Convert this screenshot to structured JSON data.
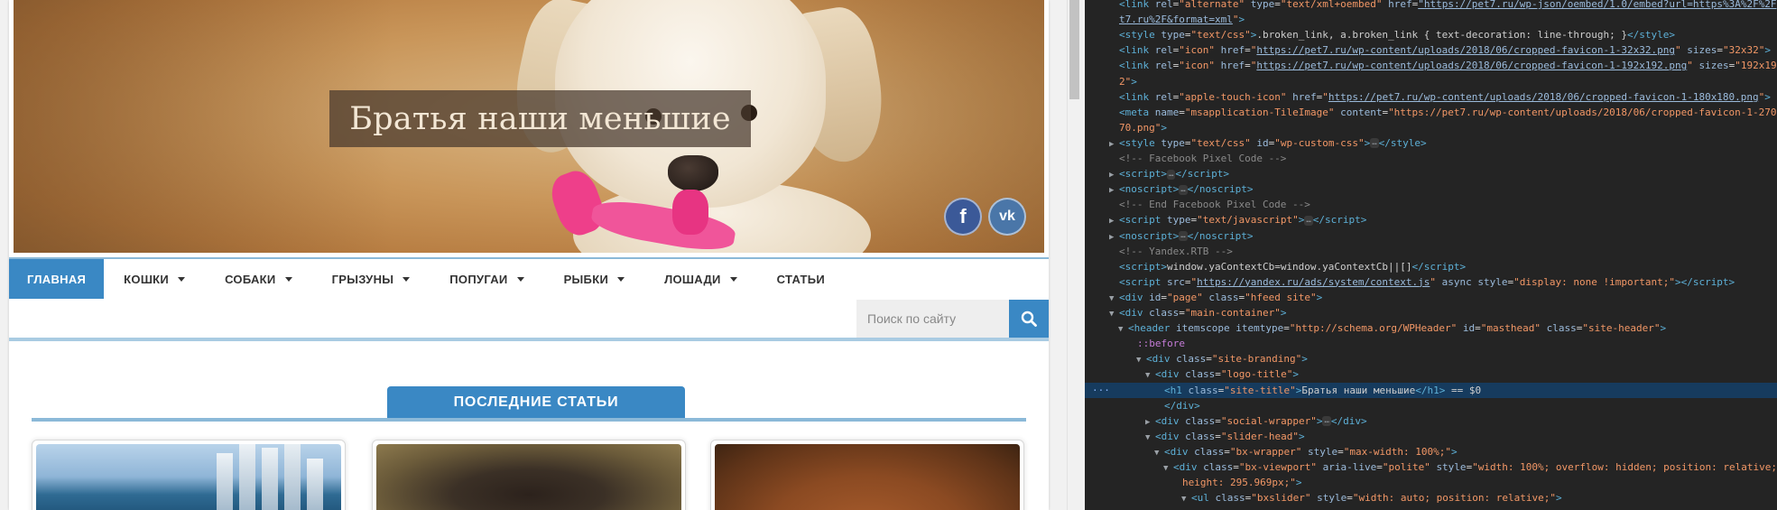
{
  "site": {
    "title": "Братья наши меньшие",
    "social": {
      "facebook_label": "f",
      "vk_label": "vk"
    },
    "nav": {
      "items": [
        {
          "label": "ГЛАВНАЯ",
          "active": true,
          "dropdown": false
        },
        {
          "label": "КОШКИ",
          "active": false,
          "dropdown": true
        },
        {
          "label": "СОБАКИ",
          "active": false,
          "dropdown": true
        },
        {
          "label": "ГРЫЗУНЫ",
          "active": false,
          "dropdown": true
        },
        {
          "label": "ПОПУГАИ",
          "active": false,
          "dropdown": true
        },
        {
          "label": "РЫБКИ",
          "active": false,
          "dropdown": true
        },
        {
          "label": "ЛОШАДИ",
          "active": false,
          "dropdown": true
        },
        {
          "label": "СТАТЬИ",
          "active": false,
          "dropdown": false
        }
      ]
    },
    "search": {
      "placeholder": "Поиск по сайту"
    },
    "latest_heading": "ПОСЛЕДНИЕ СТАТЬИ",
    "colors": {
      "accent": "#3a88c4",
      "accent_light": "#8bb9d8"
    }
  },
  "devtools": {
    "lines": [
      {
        "html": "<span class=\"t\">&lt;link</span> <span class=\"an\">rel</span>=<span class=\"av\">\"alternate\"</span> <span class=\"an\">type</span>=<span class=\"av\">\"text/xml+oembed\"</span> <span class=\"an\">href</span>=<span class=\"lk\">\"https://pet7.ru/wp-json/oembed/1.0/embed?url=https%3A%2F%2Fpe</span>"
      },
      {
        "html": "<span class=\"lk\">t7.ru%2F&amp;format=xml</span><span class=\"av\">\"</span><span class=\"t\">&gt;</span>"
      },
      {
        "html": "<span class=\"t\">&lt;style</span> <span class=\"an\">type</span>=<span class=\"av\">\"text/css\"</span><span class=\"t\">&gt;</span><span class=\"tx\">.broken_link, a.broken_link { text-decoration: line-through; }</span><span class=\"t\">&lt;/style&gt;</span>"
      },
      {
        "html": "<span class=\"t\">&lt;link</span> <span class=\"an\">rel</span>=<span class=\"av\">\"icon\"</span> <span class=\"an\">href</span>=<span class=\"av\">\"</span><span class=\"lk\">https://pet7.ru/wp-content/uploads/2018/06/cropped-favicon-1-32x32.png</span><span class=\"av\">\"</span> <span class=\"an\">sizes</span>=<span class=\"av\">\"32x32\"</span><span class=\"t\">&gt;</span>"
      },
      {
        "html": "<span class=\"t\">&lt;link</span> <span class=\"an\">rel</span>=<span class=\"av\">\"icon\"</span> <span class=\"an\">href</span>=<span class=\"av\">\"</span><span class=\"lk\">https://pet7.ru/wp-content/uploads/2018/06/cropped-favicon-1-192x192.png</span><span class=\"av\">\"</span> <span class=\"an\">sizes</span>=<span class=\"av\">\"192x19</span>"
      },
      {
        "html": "<span class=\"av\">2\"</span><span class=\"t\">&gt;</span>"
      },
      {
        "html": "<span class=\"t\">&lt;link</span> <span class=\"an\">rel</span>=<span class=\"av\">\"apple-touch-icon\"</span> <span class=\"an\">href</span>=<span class=\"av\">\"</span><span class=\"lk\">https://pet7.ru/wp-content/uploads/2018/06/cropped-favicon-1-180x180.png</span><span class=\"av\">\"</span><span class=\"t\">&gt;</span>"
      },
      {
        "html": "<span class=\"t\">&lt;meta</span> <span class=\"an\">name</span>=<span class=\"av\">\"msapplication-TileImage\"</span> <span class=\"an\">content</span>=<span class=\"av\">\"https://pet7.ru/wp-content/uploads/2018/06/cropped-favicon-1-270x2</span>"
      },
      {
        "html": "<span class=\"av\">70.png\"</span><span class=\"t\">&gt;</span>"
      },
      {
        "tri": "▶",
        "html": "<span class=\"t\">&lt;style</span> <span class=\"an\">type</span>=<span class=\"av\">\"text/css\"</span> <span class=\"an\">id</span>=<span class=\"av\">\"wp-custom-css\"</span><span class=\"t\">&gt;</span><span class=\"ell\">…</span><span class=\"t\">&lt;/style&gt;</span>"
      },
      {
        "html": "<span class=\"cm\">&lt;!-- Facebook Pixel Code --&gt;</span>"
      },
      {
        "tri": "▶",
        "html": "<span class=\"t\">&lt;script&gt;</span><span class=\"ell\">…</span><span class=\"t\">&lt;/script&gt;</span>"
      },
      {
        "tri": "▶",
        "html": "<span class=\"t\">&lt;noscript&gt;</span><span class=\"ell\">…</span><span class=\"t\">&lt;/noscript&gt;</span>"
      },
      {
        "html": "<span class=\"cm\">&lt;!-- End Facebook Pixel Code --&gt;</span>"
      },
      {
        "tri": "▶",
        "html": "<span class=\"t\">&lt;script</span> <span class=\"an\">type</span>=<span class=\"av\">\"text/javascript\"</span><span class=\"t\">&gt;</span><span class=\"ell\">…</span><span class=\"t\">&lt;/script&gt;</span>"
      },
      {
        "tri": "▶",
        "html": "<span class=\"t\">&lt;noscript&gt;</span><span class=\"ell\">…</span><span class=\"t\">&lt;/noscript&gt;</span>"
      },
      {
        "html": "<span class=\"cm\">&lt;!-- Yandex.RTB --&gt;</span>"
      },
      {
        "html": "<span class=\"t\">&lt;script&gt;</span><span class=\"tx\">window.yaContextCb=window.yaContextCb||[]</span><span class=\"t\">&lt;/script&gt;</span>"
      },
      {
        "html": "<span class=\"t\">&lt;script</span> <span class=\"an\">src</span>=<span class=\"av\">\"</span><span class=\"lk\">https://yandex.ru/ads/system/context.js</span><span class=\"av\">\"</span> <span class=\"an\">async</span> <span class=\"an\">style</span>=<span class=\"av\">\"display: none !important;\"</span><span class=\"t\">&gt;&lt;/script&gt;</span>"
      },
      {
        "tri": "▼",
        "html": "<span class=\"t\">&lt;div</span> <span class=\"an\">id</span>=<span class=\"av\">\"page\"</span> <span class=\"an\">class</span>=<span class=\"av\">\"hfeed site\"</span><span class=\"t\">&gt;</span>"
      },
      {
        "tri": "▼",
        "html": "<span class=\"t\">&lt;div</span> <span class=\"an\">class</span>=<span class=\"av\">\"main-container\"</span><span class=\"t\">&gt;</span>"
      },
      {
        "tri": "▼",
        "html": "<span class=\"t\">&lt;header</span> <span class=\"an\">itemscope</span> <span class=\"an\">itemtype</span>=<span class=\"av\">\"http://schema.org/WPHeader\"</span> <span class=\"an\">id</span>=<span class=\"av\">\"masthead\"</span> <span class=\"an\">class</span>=<span class=\"av\">\"site-header\"</span><span class=\"t\">&gt;</span>"
      },
      {
        "html": "<span class=\"ps\">::before</span>"
      },
      {
        "tri": "▼",
        "html": "<span class=\"t\">&lt;div</span> <span class=\"an\">class</span>=<span class=\"av\">\"site-branding\"</span><span class=\"t\">&gt;</span>"
      },
      {
        "tri": "▼",
        "html": "<span class=\"t\">&lt;div</span> <span class=\"an\">class</span>=<span class=\"av\">\"logo-title\"</span><span class=\"t\">&gt;</span>"
      },
      {
        "html": "<span class=\"t\">&lt;h1</span> <span class=\"an\">class</span>=<span class=\"av\">\"site-title\"</span><span class=\"t\">&gt;</span><span class=\"tx\">Братья наши меньшие</span><span class=\"t\">&lt;/h1&gt;</span><span class=\"tx\"> == $0</span>"
      },
      {
        "html": "<span class=\"t\">&lt;/div&gt;</span>"
      },
      {
        "tri": "▶",
        "html": "<span class=\"t\">&lt;div</span> <span class=\"an\">class</span>=<span class=\"av\">\"social-wrapper\"</span><span class=\"t\">&gt;</span><span class=\"ell\">…</span><span class=\"t\">&lt;/div&gt;</span>"
      },
      {
        "tri": "▼",
        "html": "<span class=\"t\">&lt;div</span> <span class=\"an\">class</span>=<span class=\"av\">\"slider-head\"</span><span class=\"t\">&gt;</span>"
      },
      {
        "tri": "▼",
        "html": "<span class=\"t\">&lt;div</span> <span class=\"an\">class</span>=<span class=\"av\">\"bx-wrapper\"</span> <span class=\"an\">style</span>=<span class=\"av\">\"max-width: 100%;\"</span><span class=\"t\">&gt;</span>"
      },
      {
        "tri": "▼",
        "html": "<span class=\"t\">&lt;div</span> <span class=\"an\">class</span>=<span class=\"av\">\"bx-viewport\"</span> <span class=\"an\">aria-live</span>=<span class=\"av\">\"polite\"</span> <span class=\"an\">style</span>=<span class=\"av\">\"width: 100%; overflow: hidden; position: relative;</span>"
      },
      {
        "html": "<span class=\"av\">height: 295.969px;\"</span><span class=\"t\">&gt;</span>"
      },
      {
        "tri": "▼",
        "html": "<span class=\"t\">&lt;ul</span> <span class=\"an\">class</span>=<span class=\"av\">\"bxslider\"</span> <span class=\"an\">style</span>=<span class=\"av\">\"width: auto; position: relative;\"</span><span class=\"t\">&gt;</span>"
      }
    ],
    "selected_index": 25,
    "gutter_dots": "···"
  }
}
